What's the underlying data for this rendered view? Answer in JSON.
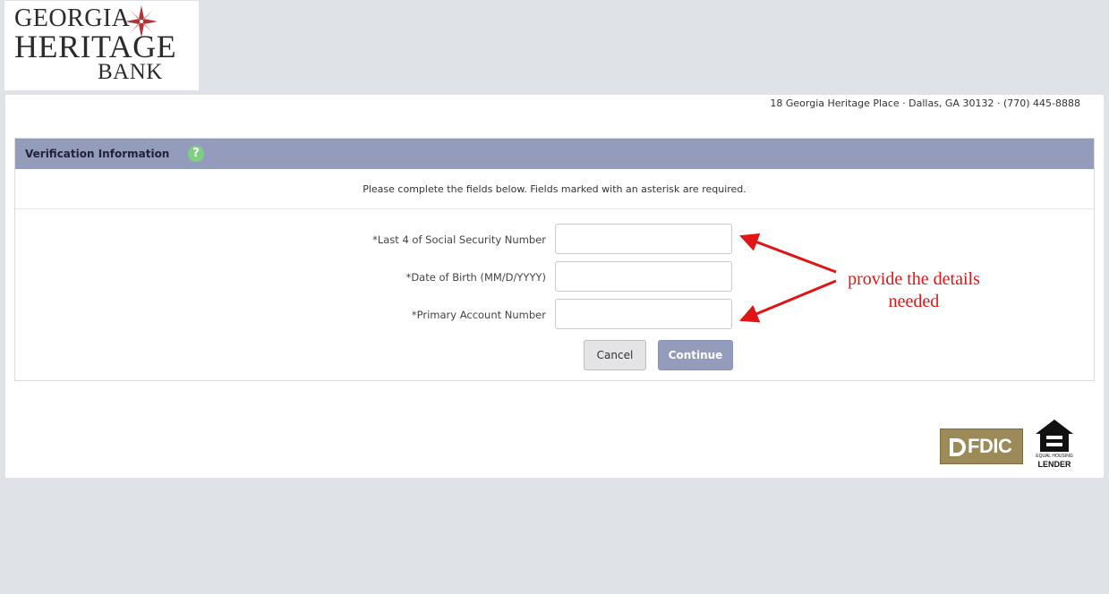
{
  "logo": {
    "line1": "GEORGIA",
    "line2": "HERITAGE",
    "line3": "BANK",
    "icon": "compass-star-icon",
    "accent": "#b0353a"
  },
  "address": "18 Georgia Heritage Place · Dallas, GA 30132 · (770) 445-8888",
  "form": {
    "title": "Verification Information",
    "help_icon": "?",
    "instruction": "Please complete the fields below. Fields marked with an asterisk are required.",
    "fields": [
      {
        "label": "*Last 4 of Social Security Number",
        "value": ""
      },
      {
        "label": "*Date of Birth (MM/D/YYYY)",
        "value": ""
      },
      {
        "label": "*Primary Account Number",
        "value": ""
      }
    ],
    "cancel_label": "Cancel",
    "continue_label": "Continue",
    "header_color": "#949cbc"
  },
  "annotation": {
    "line1": "provide the details",
    "line2": "needed",
    "color": "#e01515"
  },
  "footer": {
    "fdic_label": "FDIC",
    "equal_housing_top": "EQUAL HOUSING",
    "equal_housing_bottom": "LENDER"
  }
}
